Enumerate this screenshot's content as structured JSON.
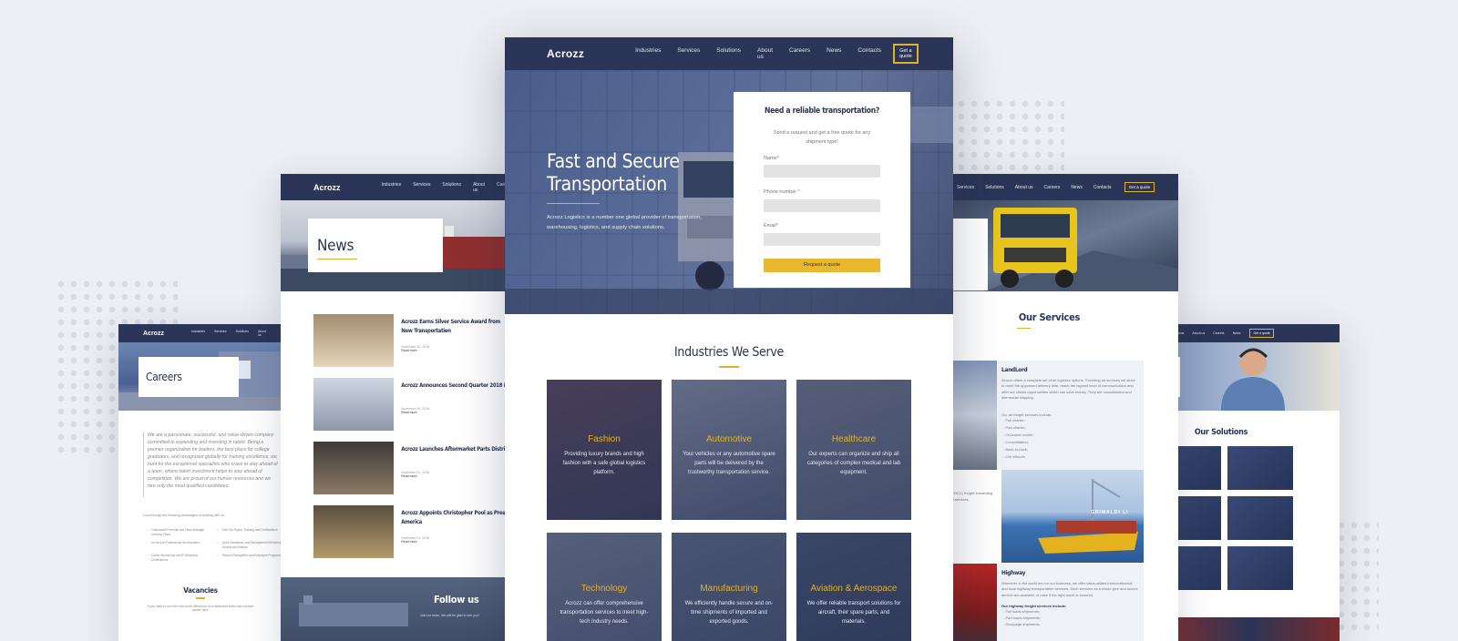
{
  "brand": "Acrozz",
  "main_nav": [
    "Industries",
    "Services",
    "Solutions",
    "About us",
    "Careers",
    "News",
    "Contacts"
  ],
  "left_nav": [
    "Industries",
    "Services",
    "Solutions",
    "About us",
    "Careers"
  ],
  "far_left_nav": [
    "Industries",
    "Services",
    "Solutions",
    "About us"
  ],
  "right_nav": [
    "Services",
    "Solutions",
    "About us",
    "Careers",
    "News",
    "Contacts"
  ],
  "far_right_nav": [
    "Solutions",
    "About us",
    "Careers",
    "News"
  ],
  "quote_btn": "Get a quote",
  "hero": {
    "title_line1": "Fast and Secure",
    "title_line2": "Transportation",
    "desc": "Acrozz Logistics is a number one global provider of transportation, warehousing, logistics, and supply chain solutions."
  },
  "form": {
    "title": "Need a reliable transportation?",
    "subtitle": "Send a request and get a free quote for any shipment type!",
    "name_label": "Name*",
    "phone_label": "Phone number *",
    "email_label": "Email*",
    "submit": "Request a quote"
  },
  "industries": {
    "title": "Industries We Serve",
    "tiles": [
      {
        "name": "Fashion",
        "desc": "Providing luxury brands and high fashion with a safe global logistics platform."
      },
      {
        "name": "Automotive",
        "desc": "Your vehicles or any automotive spare parts will be delivered by the trustworthy transportation service."
      },
      {
        "name": "Healthcare",
        "desc": "Our experts can organize and ship all categories of complex medical and lab equipment."
      },
      {
        "name": "Technology",
        "desc": "Acrozz can offer comprehensive transportation services to meet high-tech industry needs."
      },
      {
        "name": "Manufacturing",
        "desc": "We efficiently handle secure and on-time shipments of imported and exported goods."
      },
      {
        "name": "Aviation & Aerospace",
        "desc": "We offer reliable transport solutions for aircraft, their spare parts, and materials."
      }
    ]
  },
  "news": {
    "title": "News",
    "items": [
      {
        "title": "Acrozz Earns Silver Service Award from New Transportation",
        "date": "November 20, 2018",
        "more": "Read more"
      },
      {
        "title": "Acrozz Announces Second Quarter 2018 F",
        "date": "November 06, 2018",
        "more": "Read more"
      },
      {
        "title": "Acrozz Launches Aftermarket Parts Distri",
        "date": "November 01, 2018",
        "more": "Read more"
      },
      {
        "title": "Acrozz Appoints Christopher Pool as Presi America",
        "date": "November 01, 2018",
        "more": "Read more"
      }
    ],
    "follow": "Follow us",
    "follow_sub": "Join our team. We will be glad to see you!"
  },
  "careers": {
    "title": "Careers",
    "quote": "We are a passionate, successful, and value-driven company committed to expanding and investing in talent. Being a premier organization for leaders, the best place for college graduates, and recognized globally for training excellence, we hunt for the exceptional specialists who crave to stay ahead of a team, where talent investment helps to stay ahead of competition. We are proud of our human resources and we hire only the most qualified candidates.",
    "intro": "Look through the following advantages of working with us:",
    "benefits": [
      "Customized Personal and Team Manager Learning Plans",
      "Free Tax Rights, Training and Certifications",
      "On-the-job Professional Development",
      "Quick Assistance and Management Mentoring, Awards and Awards",
      "Career Workshops and Professional Certifications",
      "Reward Recognition and Employee Programs"
    ],
    "vacancies": "Vacancies",
    "vacancies_sub": "If you wish to see the real world difference of a dedicated team and a future career here."
  },
  "services": {
    "title": "Our Services",
    "landlord": "LandLord",
    "landlord_desc": "Acrozz offers a complete set of air logistics options. Providing air services we strive to meet the appointed delivery time, reach the highest level of communication and offer our clients opportunities which can save money. They are consolidation and intermodal shipping.",
    "freight_intro": "Our air freight services include:",
    "freight_list": [
      "- Full charter;",
      "- Part charter;",
      "- On-board courier;",
      "- Consolidation;",
      "- Back-to-back;",
      "- 24h Wheels."
    ],
    "partial": "(NVOCC) freight forwarding and services.",
    "ship_name": "GRIMALDI LI",
    "highway": "Highway",
    "highway_desc": "Wherever in the world we run our business, we offer value-added intercontinental and local highway transportation services. Such services as a whole give and secure service are available or raise if the right touch is ensured.",
    "highway_intro": "Our highway freight services include:",
    "highway_list": [
      "- Full loads shipments;",
      "- Part loads shipments;",
      "- Groupage shipments."
    ]
  },
  "solutions": {
    "title": "Our Solutions",
    "partial_title": "ns"
  }
}
